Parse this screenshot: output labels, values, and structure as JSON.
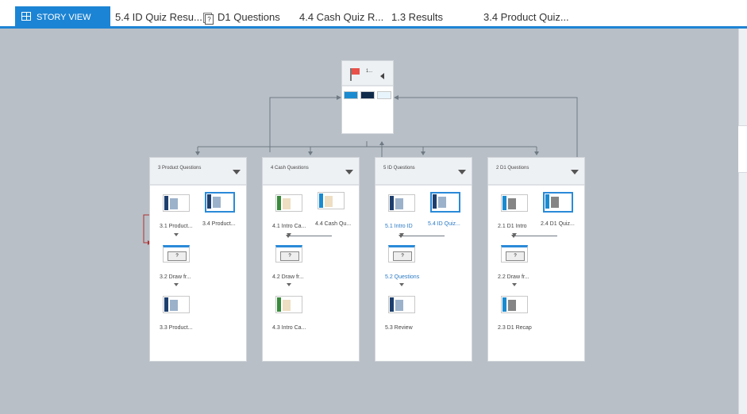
{
  "tabs": [
    {
      "label": "STORY VIEW",
      "icon": "story-view-icon",
      "active": true
    },
    {
      "label": "5.4 ID Quiz Resu..."
    },
    {
      "label": "D1 Questions",
      "icon": "question-pool-icon"
    },
    {
      "label": "4.4 Cash Quiz R..."
    },
    {
      "label": "1.3 Results"
    },
    {
      "label": "3.4 Product Quiz..."
    }
  ],
  "start": {
    "label": "1...",
    "icon": "flag-icon"
  },
  "groups": [
    {
      "title": "3 Product Questions",
      "slides": [
        {
          "label": "3.1  Product...",
          "color": "#1d3f6e"
        },
        {
          "label": "3.4  Product...",
          "color": "#1d3f6e",
          "selected": true
        },
        {
          "label": "3.2  Draw fr...",
          "question": true
        },
        {
          "label": "3.3  Product...",
          "color": "#1d3f6e"
        }
      ]
    },
    {
      "title": "4 Cash Questions",
      "slides": [
        {
          "label": "4.1  Intro Ca...",
          "color": "#3a8a3c"
        },
        {
          "label": "4.4  Cash Qu...",
          "color": "#1a8bd0"
        },
        {
          "label": "4.2  Draw fr...",
          "question": true
        },
        {
          "label": "4.3  Intro Ca...",
          "color": "#3a8a3c"
        }
      ]
    },
    {
      "title": "5 ID Questions",
      "slides": [
        {
          "label": "5.1  Intro ID",
          "color": "#1d3f6e",
          "link": true
        },
        {
          "label": "5.4  ID Quiz...",
          "color": "#1d3f6e",
          "selected": true,
          "link": true
        },
        {
          "label": "5.2  Questions",
          "question": true,
          "link": true
        },
        {
          "label": "5.3  Review",
          "color": "#1d3f6e"
        }
      ]
    },
    {
      "title": "2 D1 Questions",
      "slides": [
        {
          "label": "2.1  D1 Intro",
          "color": "#1a8bd0"
        },
        {
          "label": "2.4  D1 Quiz...",
          "color": "#1a8bd0",
          "selected": true
        },
        {
          "label": "2.2  Draw fr...",
          "question": true
        },
        {
          "label": "2.3  D1 Recap",
          "color": "#1a8bd0"
        }
      ]
    }
  ],
  "question_glyph": "?",
  "colors": {
    "accent": "#1c84d4",
    "flag": "#e8524a",
    "connector": "#6f7a83",
    "branch": "#b03030"
  }
}
